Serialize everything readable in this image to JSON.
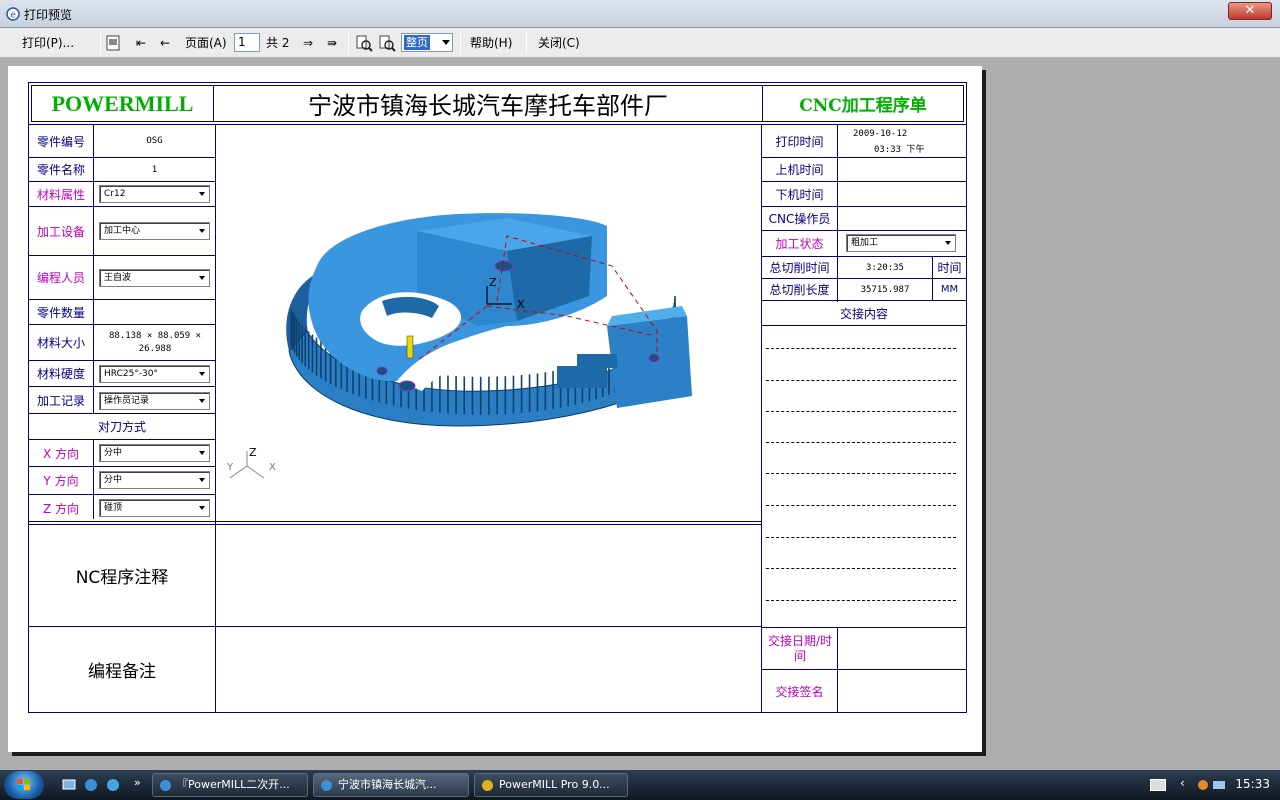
{
  "window": {
    "title": "打印预览",
    "close_label": "✕"
  },
  "toolbar": {
    "print_label": "打印(P)...",
    "page_label": "页面(A)",
    "page_value": "1",
    "total_label": "共 2",
    "zoom_value": "整页",
    "help_label": "帮助(H)",
    "close_label": "关闭(C)"
  },
  "form": {
    "logo": "POWERMILL",
    "company": "宁波市镇海长城汽车摩托车部件厂",
    "sheet_title": "CNC加工程序单",
    "left": {
      "part_no_label": "零件编号",
      "part_no_value": "OSG",
      "part_name_label": "零件名称",
      "part_name_value": "1",
      "material_label": "材料属性",
      "material_value": "Cr12",
      "machine_label": "加工设备",
      "machine_value": "加工中心",
      "programmer_label": "编程人员",
      "programmer_value": "王自波",
      "qty_label": "零件数量",
      "qty_value": "",
      "size_label": "材料大小",
      "size_value": "88.138 × 88.059 × 26.988",
      "hardness_label": "材料硬度",
      "hardness_value": "HRC25°-30°",
      "record_label": "加工记录",
      "record_value": "操作员记录",
      "tool_setting_label": "对刀方式",
      "x_label": "X 方向",
      "x_value": "分中",
      "y_label": "Y 方向",
      "y_value": "分中",
      "z_label": "Z 方向",
      "z_value": "碰顶"
    },
    "right": {
      "print_time_label": "打印时间",
      "print_date": "2009-10-12",
      "print_time": "03:33 下午",
      "on_time_label": "上机时间",
      "off_time_label": "下机时间",
      "operator_label": "CNC操作员",
      "status_label": "加工状态",
      "status_value": "粗加工",
      "total_cut_time_label": "总切削时间",
      "total_cut_time_value": "3:20:35",
      "time_unit": "时间",
      "total_cut_len_label": "总切削长度",
      "total_cut_len_value": "35715.987",
      "len_unit": "MM",
      "handover_label": "交接内容",
      "handover_date_label": "交接日期/时间",
      "handover_sign_label": "交接签名"
    },
    "nc_comment_label": "NC程序注释",
    "prog_note_label": "编程备注",
    "axis": {
      "z": "Z",
      "x": "X",
      "y": "Y"
    }
  },
  "taskbar": {
    "items": [
      "『PowerMILL二次开...",
      "宁波市镇海长城汽...",
      "PowerMILL Pro 9.0..."
    ],
    "clock": "15:33"
  },
  "colors": {
    "label": "#000080",
    "label_accent": "#c000c0",
    "logo": "#00b000",
    "model_blue": "#2f8ed6"
  }
}
